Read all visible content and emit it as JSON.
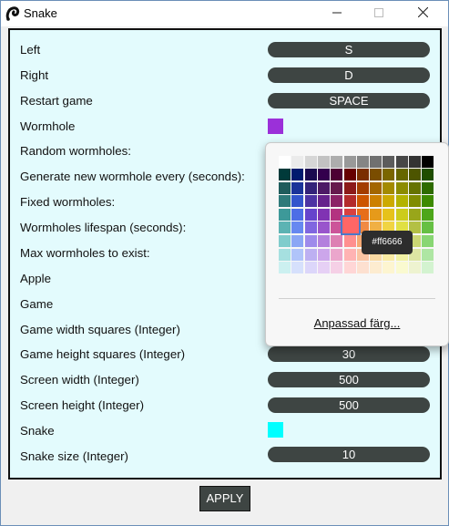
{
  "window": {
    "title": "Snake"
  },
  "rows": [
    {
      "label": "Left",
      "type": "key",
      "value": "S"
    },
    {
      "label": "Right",
      "type": "key",
      "value": "D"
    },
    {
      "label": "Restart game",
      "type": "key",
      "value": "SPACE"
    },
    {
      "label": "Wormhole",
      "type": "color",
      "color": "#9b30d9"
    },
    {
      "label": "Random wormholes:",
      "type": "none"
    },
    {
      "label": "Generate new wormhole every (seconds):",
      "type": "none"
    },
    {
      "label": "Fixed wormholes:",
      "type": "none"
    },
    {
      "label": "Wormholes lifespan (seconds):",
      "type": "none"
    },
    {
      "label": "Max wormholes to exist:",
      "type": "none"
    },
    {
      "label": "Apple",
      "type": "none"
    },
    {
      "label": "Game",
      "type": "none"
    },
    {
      "label": "Game width squares (Integer)",
      "type": "none"
    },
    {
      "label": "Game height squares (Integer)",
      "type": "key",
      "value": "30"
    },
    {
      "label": "Screen width (Integer)",
      "type": "key",
      "value": "500"
    },
    {
      "label": "Screen height (Integer)",
      "type": "key",
      "value": "500"
    },
    {
      "label": "Snake",
      "type": "color",
      "color": "#00ffff"
    },
    {
      "label": "Snake size (Integer)",
      "type": "key",
      "value": "10"
    }
  ],
  "apply_label": "APPLY",
  "color_picker": {
    "custom_label": "Anpassad färg...",
    "tooltip": "#ff6666",
    "selected_color": "#ff6666",
    "palette": [
      [
        "#ffffff",
        "#ebebeb",
        "#d6d6d6",
        "#c2c2c2",
        "#adadad",
        "#999999",
        "#858585",
        "#707070",
        "#5c5c5c",
        "#474747",
        "#333333",
        "#000000"
      ],
      [
        "#003a3a",
        "#001b6e",
        "#1a0a4f",
        "#33004d",
        "#4d0033",
        "#660000",
        "#7a2e00",
        "#7a4d00",
        "#7a6600",
        "#666600",
        "#4d5500",
        "#1f4d00"
      ],
      [
        "#1f5c5c",
        "#1a3399",
        "#33227a",
        "#4d1a66",
        "#661a4d",
        "#8c1a1a",
        "#a33d00",
        "#a36600",
        "#a38a00",
        "#8c8c00",
        "#667300",
        "#2e6b00"
      ],
      [
        "#2e7a7a",
        "#3355cc",
        "#4d33a3",
        "#66228c",
        "#8c2266",
        "#b32b2b",
        "#cc5500",
        "#cc8000",
        "#ccaa00",
        "#b3b300",
        "#808c00",
        "#3d8a00"
      ],
      [
        "#3d9999",
        "#4d6ee6",
        "#6644cc",
        "#8033b3",
        "#b33380",
        "#d94040",
        "#e66e1a",
        "#e69a1a",
        "#e6c21a",
        "#cccc1a",
        "#99a61a",
        "#4da61a"
      ],
      [
        "#5cb3b3",
        "#6688f0",
        "#8066e0",
        "#9955cc",
        "#cc5599",
        "#ff6666",
        "#f08a44",
        "#f0b044",
        "#f0d444",
        "#e0e044",
        "#b3c044",
        "#66c044"
      ],
      [
        "#80cccc",
        "#8aa6f5",
        "#9e8aeb",
        "#b380dd",
        "#dd80b3",
        "#ff8f8f",
        "#f5a873",
        "#f5c673",
        "#f5e073",
        "#ebeb73",
        "#cad673",
        "#88d673"
      ],
      [
        "#a6e0e0",
        "#b0c4fa",
        "#bdb0f2",
        "#cca6eb",
        "#eba6cc",
        "#ffb3b3",
        "#fac4a3",
        "#fadaa3",
        "#faeba3",
        "#f2f2a3",
        "#dde6a3",
        "#aee6a3"
      ],
      [
        "#ccf0f0",
        "#d6e0fc",
        "#dcd6fa",
        "#e6d0f5",
        "#f5d0e6",
        "#ffd6d6",
        "#fde0d0",
        "#fdecd0",
        "#fdf5d0",
        "#fafad0",
        "#eef3d0",
        "#d3f3d0"
      ]
    ]
  }
}
